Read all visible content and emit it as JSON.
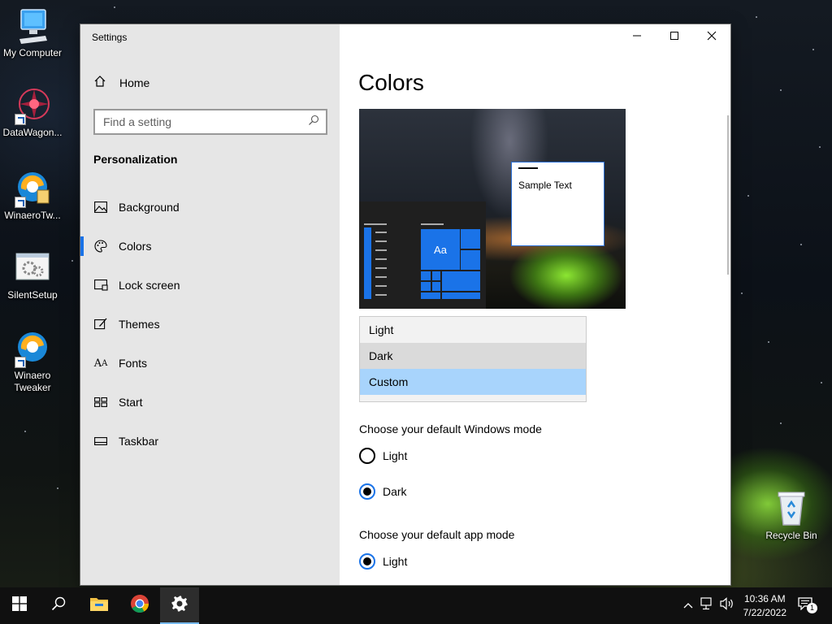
{
  "desktop": {
    "icons": [
      {
        "label": "My Computer"
      },
      {
        "label": "DataWagon..."
      },
      {
        "label": "WinaeroTw..."
      },
      {
        "label": "SilentSetup"
      },
      {
        "label": "Winaero Tweaker"
      },
      {
        "label": "Recycle Bin"
      }
    ]
  },
  "window": {
    "title": "Settings",
    "controls": {
      "minimize": "minimize-icon",
      "maximize": "maximize-icon",
      "close": "close-icon"
    }
  },
  "sidebar": {
    "home_label": "Home",
    "search_placeholder": "Find a setting",
    "section_title": "Personalization",
    "items": [
      {
        "label": "Background",
        "icon": "picture-icon"
      },
      {
        "label": "Colors",
        "icon": "palette-icon",
        "active": true
      },
      {
        "label": "Lock screen",
        "icon": "lock-screen-icon"
      },
      {
        "label": "Themes",
        "icon": "brush-icon"
      },
      {
        "label": "Fonts",
        "icon": "font-icon"
      },
      {
        "label": "Start",
        "icon": "start-icon"
      },
      {
        "label": "Taskbar",
        "icon": "taskbar-icon"
      }
    ]
  },
  "main": {
    "title": "Colors",
    "preview": {
      "sample_text": "Sample Text",
      "tile_text": "Aa"
    },
    "color_dropdown": {
      "options": [
        "Light",
        "Dark",
        "Custom"
      ],
      "selected": "Custom"
    },
    "windows_mode": {
      "label": "Choose your default Windows mode",
      "options": [
        "Light",
        "Dark"
      ],
      "selected": "Dark"
    },
    "app_mode": {
      "label": "Choose your default app mode",
      "options": [
        "Light"
      ],
      "selected": "Light"
    }
  },
  "taskbar": {
    "time": "10:36 AM",
    "date": "7/22/2022",
    "notification_count": "1",
    "accent": "#76b9ed"
  }
}
